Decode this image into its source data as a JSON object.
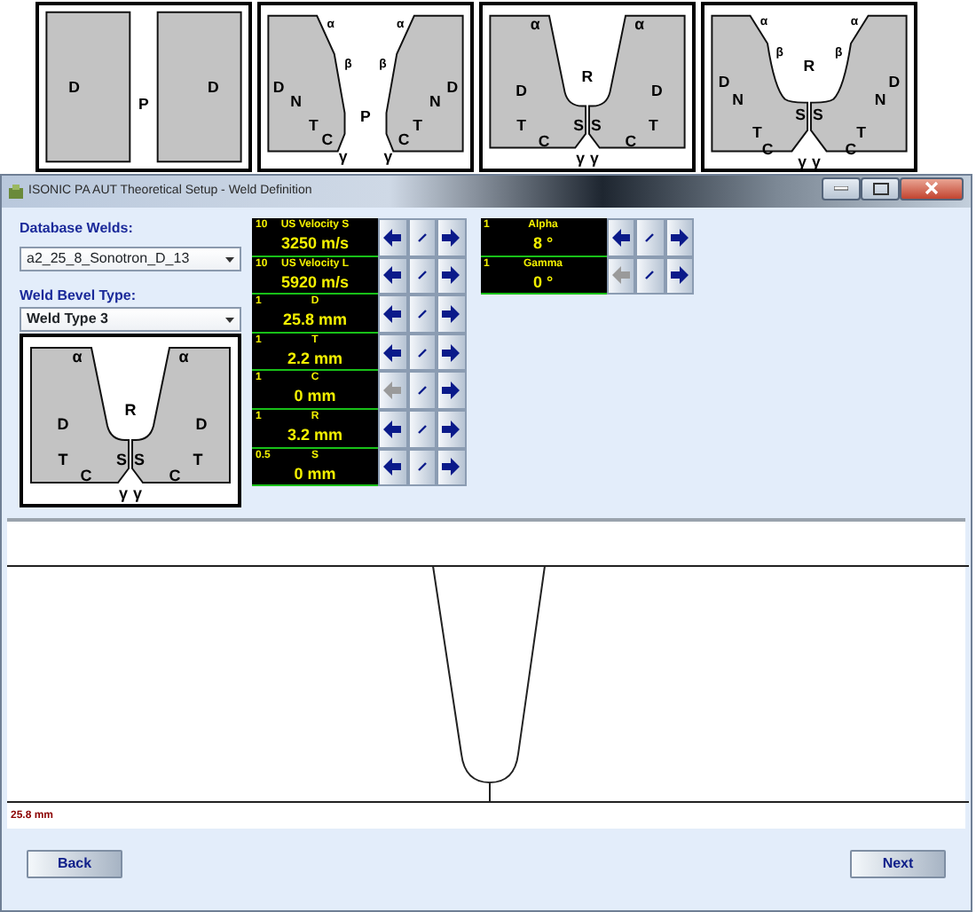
{
  "thumbnails": [
    {
      "kind": "square",
      "labels": [
        "D",
        "D",
        "P"
      ]
    },
    {
      "kind": "double-v",
      "labels": [
        "α",
        "α",
        "β",
        "β",
        "D",
        "D",
        "N",
        "N",
        "T",
        "T",
        "C",
        "C",
        "γ",
        "γ",
        "P"
      ]
    },
    {
      "kind": "u",
      "labels": [
        "α",
        "α",
        "R",
        "D",
        "D",
        "T",
        "S",
        "S",
        "T",
        "C",
        "C",
        "γ",
        "γ"
      ]
    },
    {
      "kind": "double-u",
      "labels": [
        "α",
        "α",
        "β",
        "β",
        "R",
        "D",
        "D",
        "N",
        "N",
        "S",
        "S",
        "T",
        "T",
        "C",
        "C",
        "γ",
        "γ"
      ]
    }
  ],
  "window": {
    "title": "ISONIC PA AUT Theoretical Setup - Weld Definition"
  },
  "database_welds": {
    "label": "Database Welds:",
    "value": "a2_25_8_Sonotron_D_13"
  },
  "weld_bevel_type": {
    "label": "Weld Bevel Type:",
    "value": "Weld Type 3",
    "diagram": {
      "kind": "u",
      "labels": [
        "α",
        "α",
        "R",
        "D",
        "D",
        "T",
        "S",
        "S",
        "T",
        "C",
        "C",
        "γ",
        "γ"
      ]
    }
  },
  "parameter_columns": [
    [
      {
        "step": "10",
        "name": "US Velocity S",
        "value": "3250 m/s",
        "decrease_disabled": false
      },
      {
        "step": "10",
        "name": "US Velocity L",
        "value": "5920 m/s",
        "decrease_disabled": false
      },
      {
        "step": "1",
        "name": "D",
        "value": "25.8 mm",
        "decrease_disabled": false
      },
      {
        "step": "1",
        "name": "T",
        "value": "2.2 mm",
        "decrease_disabled": false
      },
      {
        "step": "1",
        "name": "C",
        "value": "0 mm",
        "decrease_disabled": true
      },
      {
        "step": "1",
        "name": "R",
        "value": "3.2 mm",
        "decrease_disabled": false
      },
      {
        "step": "0.5",
        "name": "S",
        "value": "0 mm",
        "decrease_disabled": false
      }
    ],
    [
      {
        "step": "1",
        "name": "Alpha",
        "value": "8 °",
        "decrease_disabled": false
      },
      {
        "step": "1",
        "name": "Gamma",
        "value": "0 °",
        "decrease_disabled": true
      }
    ]
  ],
  "plot": {
    "depth_label": "25.8 mm"
  },
  "buttons": [
    "Back",
    "Next"
  ]
}
